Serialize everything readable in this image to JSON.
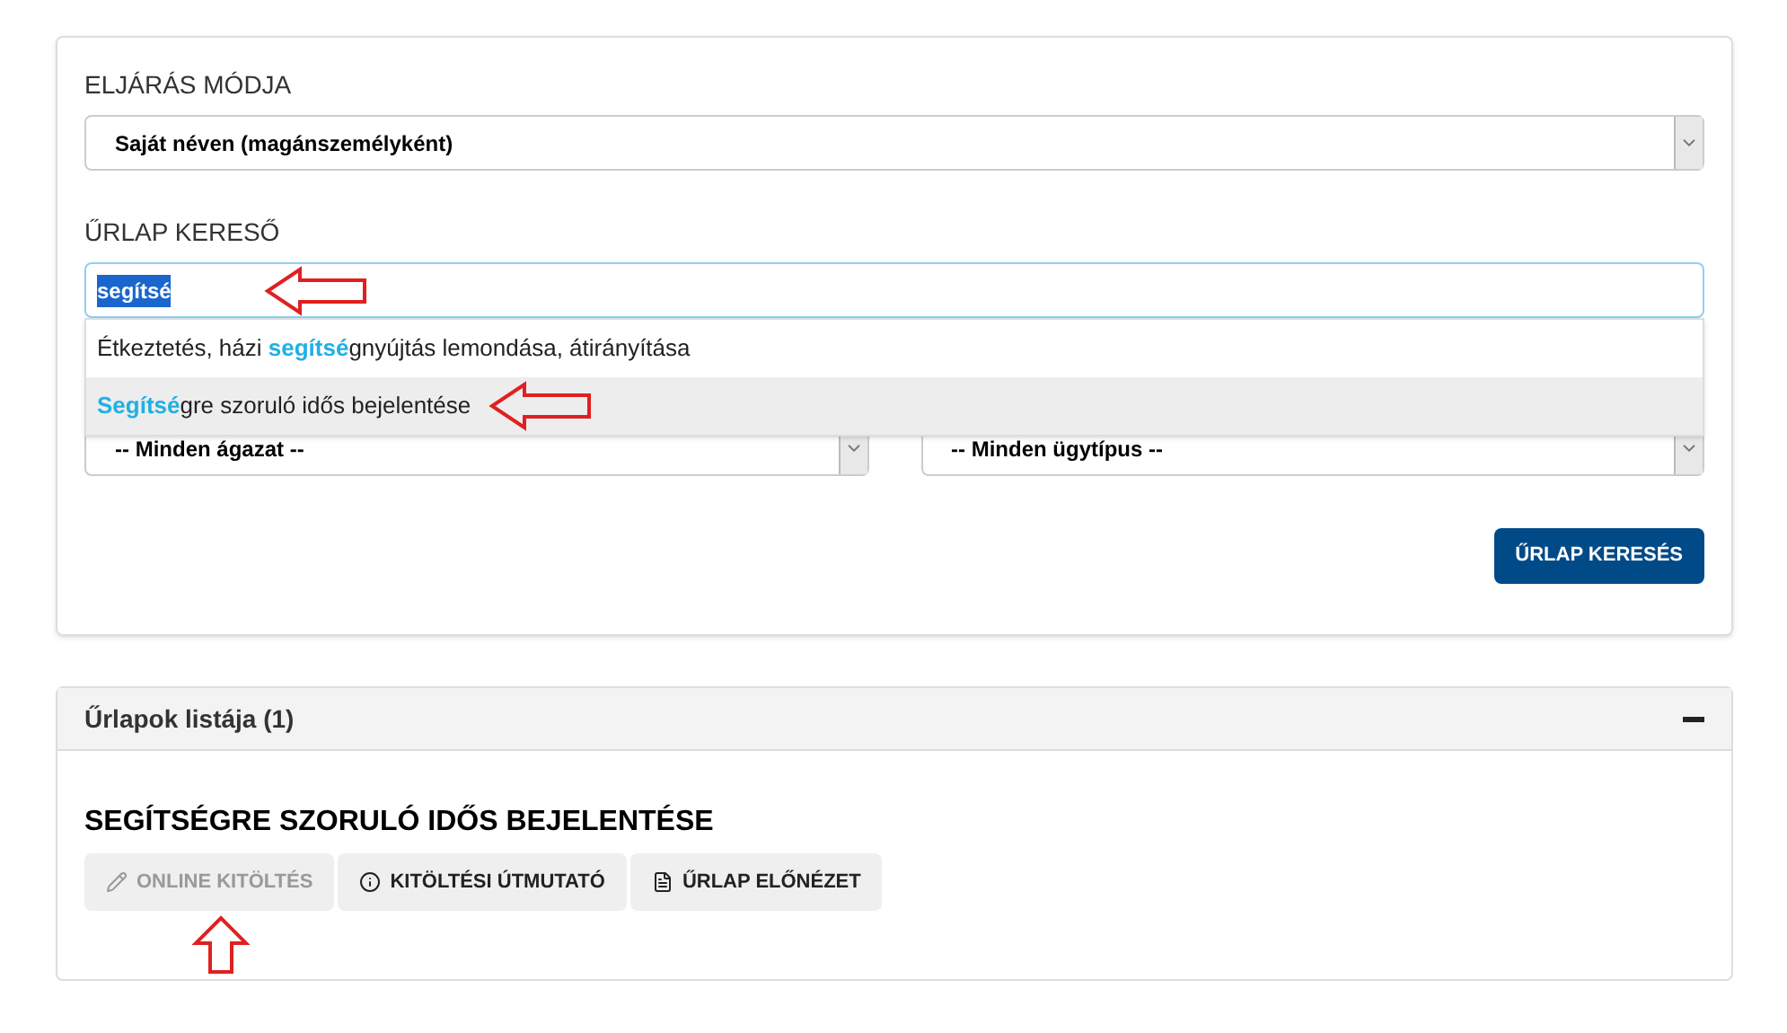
{
  "procedure": {
    "label": "ELJÁRÁS MÓDJA",
    "value": "Saját néven (magánszemélyként)"
  },
  "search": {
    "label": "ŰRLAP KERESŐ",
    "value": "segítsé",
    "suggestions": [
      {
        "text": "Étkeztetés, házi **segítsé**gnyújtás lemondása, átirányítása",
        "selected": false
      },
      {
        "text": "**Segítsé**gre szoruló idős bejelentése",
        "selected": true
      }
    ]
  },
  "filters": [
    {
      "value": "-- Minden ágazat --"
    },
    {
      "value": "-- Minden ügytípus --"
    }
  ],
  "search_button": "ŰRLAP KERESÉS",
  "results": {
    "title": "Űrlapok listája (1)",
    "expanded": true,
    "form_title": "SEGÍTSÉGRE SZORULÓ IDŐS BEJELENTÉSE",
    "actions": [
      {
        "kind": "edit",
        "label": "ONLINE KITÖLTÉS",
        "disabled": true
      },
      {
        "kind": "info",
        "label": "KITÖLTÉSI ÚTMUTATÓ",
        "disabled": false
      },
      {
        "kind": "pdf",
        "label": "ŰRLAP ELŐNÉZET",
        "disabled": false
      }
    ]
  }
}
